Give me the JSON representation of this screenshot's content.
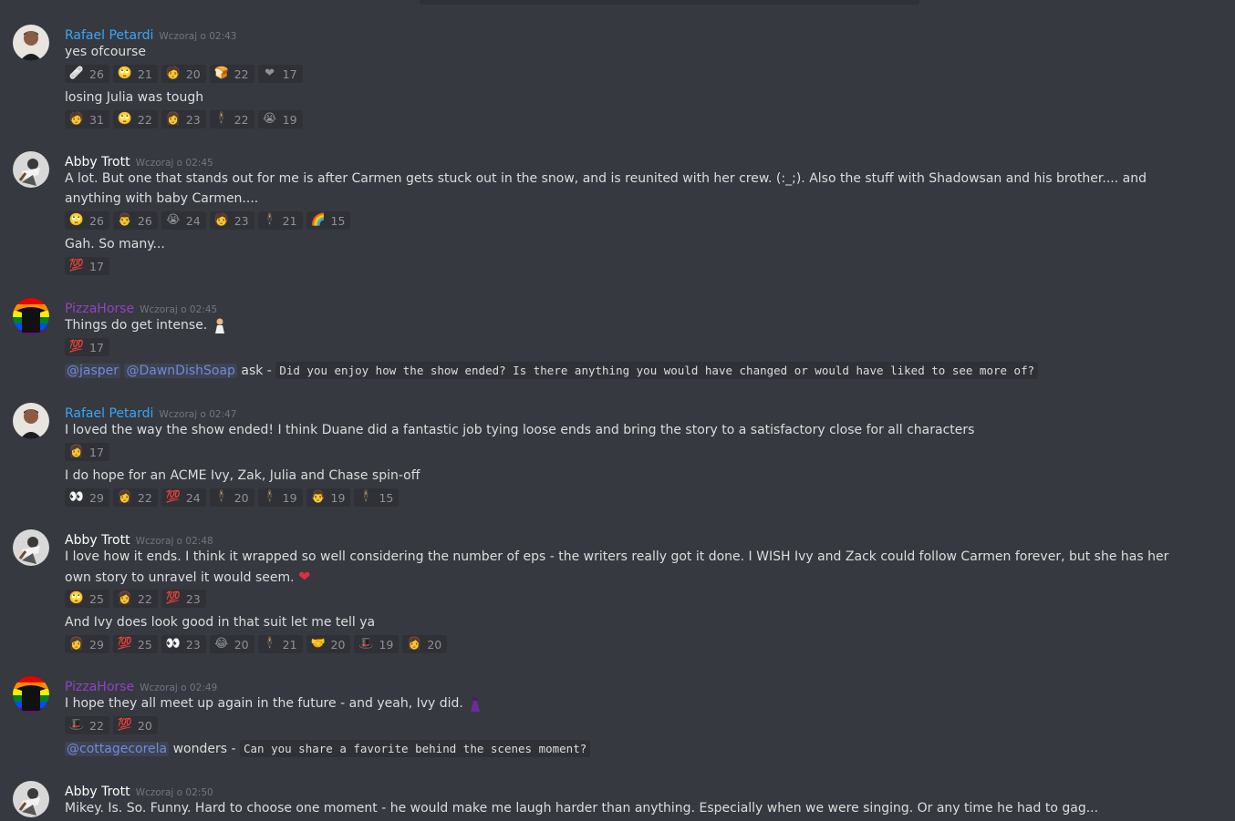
{
  "colors": {
    "bg": "#36393f",
    "pill_bg": "#2f3136",
    "mention": "#7289da",
    "rafael": "#3ba5f5",
    "abby": "#ffffff",
    "pizza": "#8f44c4",
    "timestamp": "#72767d"
  },
  "messages": [
    {
      "author": "Rafael Petardi",
      "timestamp": "Wczoraj o 02:43",
      "lines": [
        {
          "text": "yes ofcourse",
          "reactions": [
            {
              "icon": "bandage-icon",
              "glyph": "🩹",
              "count": "26"
            },
            {
              "icon": "face-icon",
              "glyph": "🙄",
              "count": "21"
            },
            {
              "icon": "custom-face-icon",
              "glyph": "🧑",
              "count": "20"
            },
            {
              "icon": "bread-icon",
              "glyph": "🍞",
              "count": "22"
            },
            {
              "icon": "heart-icon",
              "glyph": "❤",
              "count": "17"
            }
          ]
        },
        {
          "text": "losing Julia was tough",
          "reactions": [
            {
              "icon": "custom-face-icon",
              "glyph": "🧑",
              "count": "31"
            },
            {
              "icon": "face-icon",
              "glyph": "🙄",
              "count": "22"
            },
            {
              "icon": "custom-woman-icon",
              "glyph": "👩",
              "count": "23"
            },
            {
              "icon": "custom-figure-icon",
              "glyph": "🕴",
              "count": "22"
            },
            {
              "icon": "crying-face-icon",
              "glyph": "😭",
              "count": "19"
            }
          ]
        }
      ]
    },
    {
      "author": "Abby Trott",
      "timestamp": "Wczoraj o 02:45",
      "lines": [
        {
          "text": "A lot. But one that stands out for me is after Carmen gets stuck out in the snow, and is reunited with her crew. (:_;). Also the stuff with Shadowsan and his brother.... and anything with baby Carmen....",
          "reactions": [
            {
              "icon": "face-icon",
              "glyph": "🙄",
              "count": "26"
            },
            {
              "icon": "custom-man-icon",
              "glyph": "👨",
              "count": "26"
            },
            {
              "icon": "crying-face-icon",
              "glyph": "😭",
              "count": "24"
            },
            {
              "icon": "custom-face-icon",
              "glyph": "🧑",
              "count": "23"
            },
            {
              "icon": "custom-figure-icon",
              "glyph": "🕴",
              "count": "21"
            },
            {
              "icon": "rainbow-icon",
              "glyph": "🌈",
              "count": "15"
            }
          ]
        },
        {
          "text": "Gah. So many...",
          "reactions": [
            {
              "icon": "hundred-icon",
              "glyph": "💯",
              "count": "17"
            }
          ]
        }
      ]
    },
    {
      "author": "PizzaHorse",
      "timestamp": "Wczoraj o 02:45",
      "lines": [
        {
          "text": "Things do get intense.",
          "reactions": [
            {
              "icon": "hundred-icon",
              "glyph": "💯",
              "count": "17"
            }
          ]
        },
        {
          "mentions": [
            "@jasper",
            "@DawnDishSoap"
          ],
          "verb": "ask - ",
          "code": "Did you enjoy how the show ended? Is there anything you would have changed or would have liked to see more of?"
        }
      ]
    },
    {
      "author": "Rafael Petardi",
      "timestamp": "Wczoraj o 02:47",
      "lines": [
        {
          "text": "I loved the way the show ended!  I think Duane did a fantastic job tying loose ends and bring the story to a satisfactory close for all characters",
          "reactions": [
            {
              "icon": "custom-woman-icon",
              "glyph": "👩",
              "count": "17"
            }
          ]
        },
        {
          "text": "I do hope for an ACME Ivy, Zak, Julia and Chase spin-off",
          "reactions": [
            {
              "icon": "custom-eyes-icon",
              "glyph": "👀",
              "count": "29"
            },
            {
              "icon": "custom-woman-icon",
              "glyph": "👩",
              "count": "22"
            },
            {
              "icon": "hundred-icon",
              "glyph": "💯",
              "count": "24"
            },
            {
              "icon": "custom-figure-icon",
              "glyph": "🕴",
              "count": "20"
            },
            {
              "icon": "custom-figure-icon",
              "glyph": "🕴",
              "count": "19"
            },
            {
              "icon": "custom-man-icon",
              "glyph": "👨",
              "count": "19"
            },
            {
              "icon": "custom-figure-icon",
              "glyph": "🕴",
              "count": "15"
            }
          ]
        }
      ]
    },
    {
      "author": "Abby Trott",
      "timestamp": "Wczoraj o 02:48",
      "lines": [
        {
          "text": "I love how it ends. I think it wrapped so well considering the number of eps - the writers really got it done. I WISH Ivy and Zack could follow Carmen forever, but she has her own story to unravel it would seem.",
          "reactions": [
            {
              "icon": "face-icon",
              "glyph": "🙄",
              "count": "25"
            },
            {
              "icon": "custom-woman-icon",
              "glyph": "👩",
              "count": "22"
            },
            {
              "icon": "hundred-icon",
              "glyph": "💯",
              "count": "23"
            }
          ]
        },
        {
          "text": "And Ivy does look good in that suit let me tell ya",
          "reactions": [
            {
              "icon": "custom-woman-icon",
              "glyph": "👩",
              "count": "29"
            },
            {
              "icon": "hundred-icon",
              "glyph": "💯",
              "count": "25"
            },
            {
              "icon": "custom-eyes-icon",
              "glyph": "👀",
              "count": "23"
            },
            {
              "icon": "laughing-face-icon",
              "glyph": "😂",
              "count": "20"
            },
            {
              "icon": "custom-figure-icon",
              "glyph": "🕴",
              "count": "21"
            },
            {
              "icon": "handshake-icon",
              "glyph": "🤝",
              "count": "20"
            },
            {
              "icon": "custom-hat-icon",
              "glyph": "🎩",
              "count": "19"
            },
            {
              "icon": "custom-redhead-icon",
              "glyph": "👩",
              "count": "20"
            }
          ]
        }
      ]
    },
    {
      "author": "PizzaHorse",
      "timestamp": "Wczoraj o 02:49",
      "lines": [
        {
          "text": "I hope they all meet up again in the future - and yeah, Ivy did.",
          "reactions": [
            {
              "icon": "custom-hat-icon",
              "glyph": "🎩",
              "count": "22"
            },
            {
              "icon": "hundred-icon",
              "glyph": "💯",
              "count": "20"
            }
          ]
        },
        {
          "mentions": [
            "@cottagecorela"
          ],
          "verb": "wonders - ",
          "code": "Can you share a favorite behind the scenes moment?"
        }
      ]
    },
    {
      "author": "Abby Trott",
      "timestamp": "Wczoraj o 02:50",
      "lines": [
        {
          "text": "Mikey. Is. So. Funny. Hard to choose one moment - he would make me laugh harder than anything. Especially when we were singing. Or any time he had to gag..."
        }
      ]
    }
  ]
}
